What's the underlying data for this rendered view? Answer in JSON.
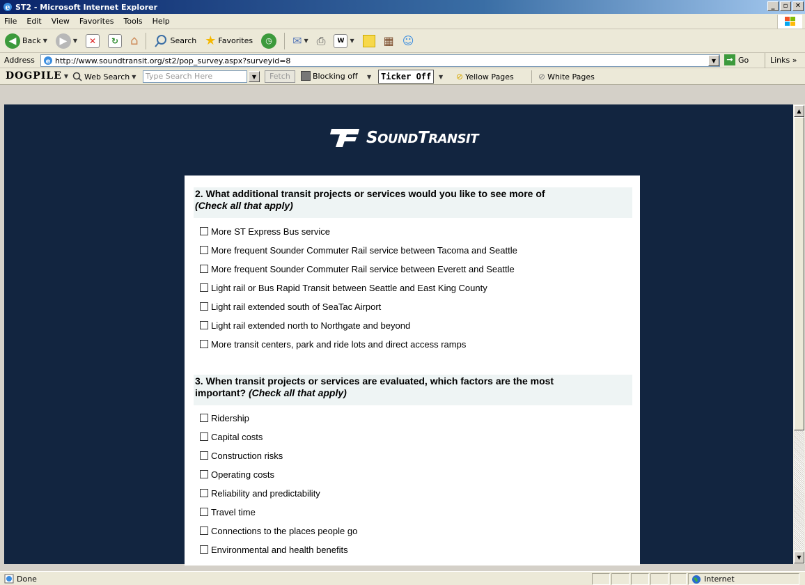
{
  "window": {
    "title": "ST2 - Microsoft Internet Explorer",
    "buttons": [
      "_",
      "▫",
      "✕"
    ]
  },
  "menu": [
    "File",
    "Edit",
    "View",
    "Favorites",
    "Tools",
    "Help"
  ],
  "toolbar": {
    "back_label": "Back",
    "search_label": "Search",
    "favorites_label": "Favorites"
  },
  "address": {
    "label": "Address",
    "url": "http://www.soundtransit.org/st2/pop_survey.aspx?surveyid=8",
    "go_label": "Go",
    "links_label": "Links »"
  },
  "searchbar": {
    "brand": "DOGPILE",
    "web_search_label": "Web Search",
    "placeholder": "Type Search Here",
    "fetch_label": "Fetch",
    "blocking_label": "Blocking off",
    "ticker_label": "Ticker Off",
    "yellow_pages_label": "Yellow Pages",
    "white_pages_label": "White Pages"
  },
  "logo": {
    "first": "S",
    "first_rest": "OUND",
    "second": "T",
    "second_rest": "RANSIT"
  },
  "survey": {
    "q2": {
      "title": "2. What additional transit projects or services would you like to see more of",
      "hint": "(Check all that apply)",
      "options": [
        "More ST Express Bus service",
        "More frequent Sounder Commuter Rail service between Tacoma and Seattle",
        "More frequent Sounder Commuter Rail service between Everett and Seattle",
        "Light rail or Bus Rapid Transit between Seattle and East King County",
        "Light rail extended south of SeaTac Airport",
        "Light rail extended north to Northgate and beyond",
        "More transit centers, park and ride lots and direct access ramps"
      ]
    },
    "q3": {
      "title_line1": "3. When transit projects or services are evaluated, which factors are the most",
      "title_line2": "important?",
      "hint": "(Check all that apply)",
      "options": [
        "Ridership",
        "Capital costs",
        "Construction risks",
        "Operating costs",
        "Reliability and predictability",
        "Travel time",
        "Connections to the places people go",
        "Environmental and health benefits"
      ]
    }
  },
  "status": {
    "text": "Done",
    "zone": "Internet"
  }
}
